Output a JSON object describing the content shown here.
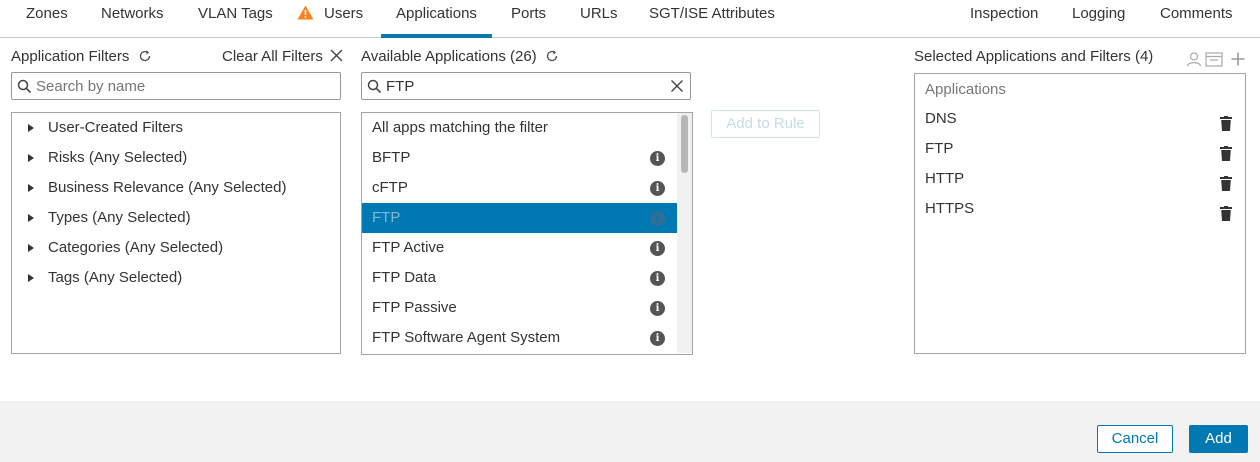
{
  "tabs": [
    {
      "label": "Zones"
    },
    {
      "label": "Networks"
    },
    {
      "label": "VLAN Tags"
    },
    {
      "label": "Users",
      "icon": "warning-icon"
    },
    {
      "label": "Applications",
      "active": true
    },
    {
      "label": "Ports"
    },
    {
      "label": "URLs"
    },
    {
      "label": "SGT/ISE Attributes"
    },
    {
      "label": "Inspection"
    },
    {
      "label": "Logging"
    },
    {
      "label": "Comments"
    }
  ],
  "filters": {
    "title": "Application Filters",
    "clear_label": "Clear All Filters",
    "search_placeholder": "Search by name",
    "items": [
      {
        "label": "User-Created Filters"
      },
      {
        "label": "Risks (Any Selected)"
      },
      {
        "label": "Business Relevance (Any Selected)"
      },
      {
        "label": "Types (Any Selected)"
      },
      {
        "label": "Categories (Any Selected)"
      },
      {
        "label": "Tags (Any Selected)"
      }
    ]
  },
  "available": {
    "title": "Available Applications (26)",
    "search_value": "FTP",
    "items": [
      {
        "label": "All apps matching the filter",
        "info": false
      },
      {
        "label": "BFTP",
        "info": true
      },
      {
        "label": "cFTP",
        "info": true
      },
      {
        "label": "FTP",
        "info": true,
        "selected": true
      },
      {
        "label": "FTP Active",
        "info": true
      },
      {
        "label": "FTP Data",
        "info": true
      },
      {
        "label": "FTP Passive",
        "info": true
      },
      {
        "label": "FTP Software Agent System",
        "info": true
      }
    ]
  },
  "add_to_rule_label": "Add to Rule",
  "selected": {
    "title": "Selected Applications and Filters (4)",
    "section_label": "Applications",
    "items": [
      {
        "label": "DNS"
      },
      {
        "label": "FTP"
      },
      {
        "label": "HTTP"
      },
      {
        "label": "HTTPS"
      }
    ]
  },
  "footer": {
    "cancel_label": "Cancel",
    "add_label": "Add"
  },
  "colors": {
    "accent": "#0079b3",
    "warning": "#f5821f"
  }
}
